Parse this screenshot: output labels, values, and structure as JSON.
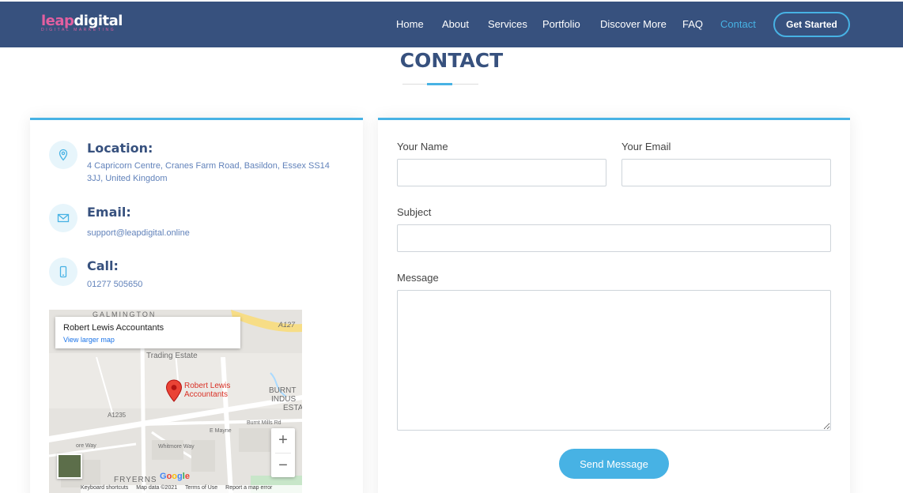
{
  "header": {
    "logo_main_a": "leap",
    "logo_main_b": "digital",
    "logo_sub": "DIGITAL MARKETING",
    "nav": [
      {
        "label": "Home"
      },
      {
        "label": "About"
      },
      {
        "label": "Services"
      },
      {
        "label": "Portfolio"
      },
      {
        "label": "Discover More"
      },
      {
        "label": "FAQ"
      },
      {
        "label": "Contact",
        "active": true
      }
    ],
    "cta": "Get Started"
  },
  "section": {
    "title": "CONTACT"
  },
  "info": {
    "location": {
      "title": "Location:",
      "text": "4 Capricorn Centre, Cranes Farm Road, Basildon, Essex SS14 3JJ, United Kingdom",
      "icon": "map-pin-icon"
    },
    "email": {
      "title": "Email:",
      "text": "support@leapdigital.online",
      "icon": "envelope-icon"
    },
    "call": {
      "title": "Call:",
      "text": "01277 505650",
      "icon": "phone-icon"
    }
  },
  "map": {
    "card_title": "Robert Lewis Accountants",
    "card_link": "View larger map",
    "labels": {
      "top_left": "GALMINGTON",
      "road_a127": "A127",
      "trading": "Trading Estate",
      "burnt": "BURNT",
      "indus": "INDUS",
      "esta": "ESTA",
      "a1235": "A1235",
      "burnt_mills": "Burnt Mills Rd",
      "ore_way": "ore Way",
      "whitmore": "Whitmore Way",
      "e_mayne": "E Mayne",
      "fryerns": "FRYERNS"
    },
    "pin_label_1": "Robert Lewis",
    "pin_label_2": "Accountants",
    "zoom_in": "+",
    "zoom_out": "−",
    "google": "Google",
    "footer": [
      "Keyboard shortcuts",
      "Map data ©2021",
      "Terms of Use",
      "Report a map error"
    ]
  },
  "form": {
    "name_label": "Your Name",
    "email_label": "Your Email",
    "subject_label": "Subject",
    "message_label": "Message",
    "name_value": "",
    "email_value": "",
    "subject_value": "",
    "message_value": "",
    "submit": "Send Message"
  },
  "colors": {
    "header_bg": "#37517e",
    "accent": "#47b2e4",
    "title": "#37517e",
    "link": "#6182ba"
  }
}
